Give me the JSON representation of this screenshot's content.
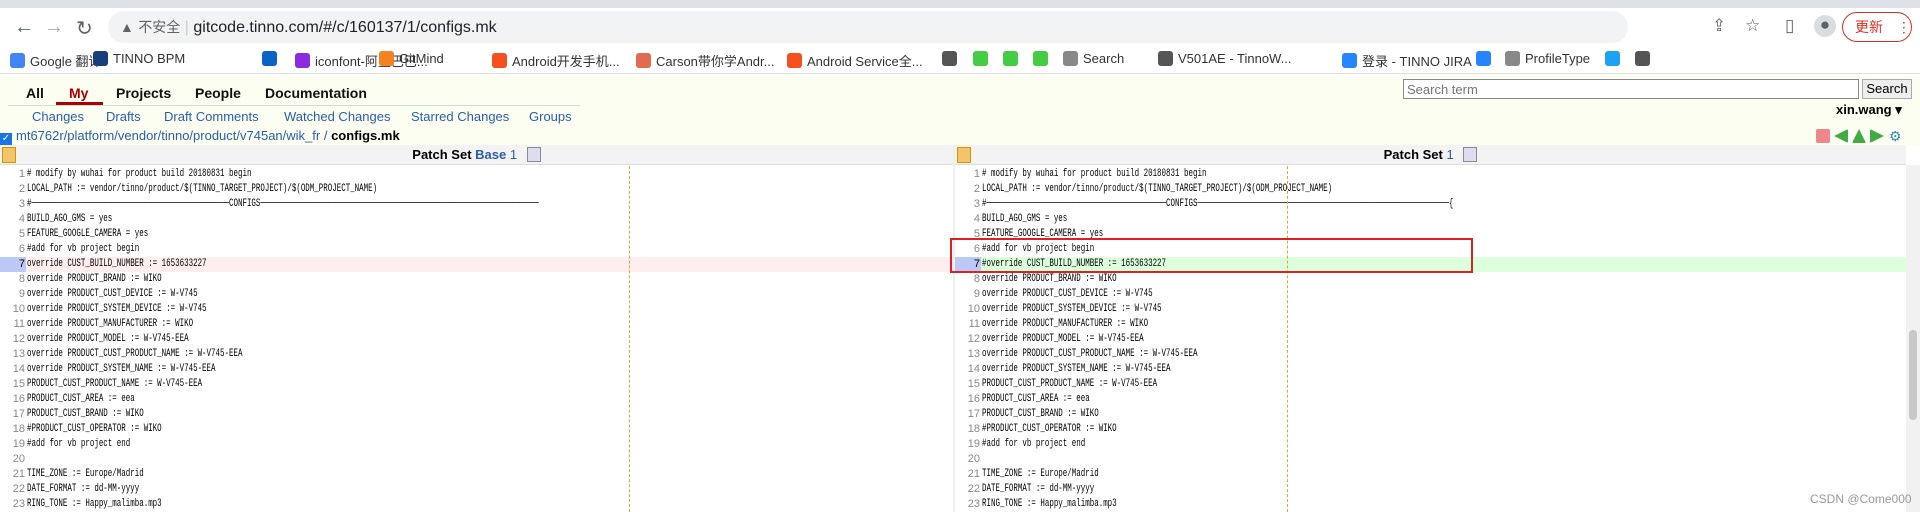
{
  "browser": {
    "security": "不安全",
    "url": "gitcode.tinno.com/#/c/160137/1/configs.mk",
    "update_label": "更新"
  },
  "bookmarks": [
    {
      "label": "Google 翻译",
      "icon": "google-translate-icon",
      "color": "#4285f4"
    },
    {
      "label": "TINNO BPM",
      "icon": "tn-icon",
      "color": "#1a3d7c"
    },
    {
      "label": "",
      "icon": "outlook-icon",
      "color": "#0a64c8"
    },
    {
      "label": "iconfont-阿里巴巴...",
      "icon": "iconfont-icon",
      "color": "#8a2be2"
    },
    {
      "label": "GitMind",
      "icon": "gitmind-icon",
      "color": "#f58220"
    },
    {
      "label": "Android开发手机...",
      "icon": "csdn-icon",
      "color": "#f4511e"
    },
    {
      "label": "Carson带你学Andr...",
      "icon": "jianshu-icon",
      "color": "#e06b50"
    },
    {
      "label": "Android Service全...",
      "icon": "csdn-icon",
      "color": "#f4511e"
    },
    {
      "label": "",
      "icon": "globe-icon",
      "color": "#555"
    },
    {
      "label": "",
      "icon": "app-icon",
      "color": "#4c4"
    },
    {
      "label": "",
      "icon": "app-icon",
      "color": "#4c4"
    },
    {
      "label": "",
      "icon": "app-icon",
      "color": "#4c4"
    },
    {
      "label": "Search",
      "icon": "braces-icon",
      "color": "#888"
    },
    {
      "label": "V501AE - TinnoW...",
      "icon": "globe-icon",
      "color": "#555"
    },
    {
      "label": "登录 - TINNO JIRA",
      "icon": "jira-icon",
      "color": "#2684ff"
    },
    {
      "label": "",
      "icon": "confluence-icon",
      "color": "#2684ff"
    },
    {
      "label": "ProfileType",
      "icon": "braces-icon",
      "color": "#888"
    },
    {
      "label": "",
      "icon": "twitter-icon",
      "color": "#1da1f2"
    },
    {
      "label": "",
      "icon": "globe-icon",
      "color": "#555"
    }
  ],
  "menu": [
    "All",
    "My",
    "Projects",
    "People",
    "Documentation"
  ],
  "submenu": [
    "Changes",
    "Drafts",
    "Draft Comments",
    "Watched Changes",
    "Starred Changes",
    "Groups"
  ],
  "search": {
    "placeholder": "Search term",
    "button": "Search"
  },
  "user": "xin.wang ▾",
  "breadcrumb": {
    "path": "mt6762r/platform/vendor/tinno/product/v745an/wik_fr",
    "sep": " / ",
    "file": "configs.mk"
  },
  "left": {
    "label": "Patch Set",
    "ps1": "Base",
    "ps2": "1"
  },
  "right": {
    "label": "Patch Set",
    "ps1": "1"
  },
  "left_lines": [
    "# modify by wuhai for product build 20180831 begin",
    "LOCAL_PATH := vendor/tinno/product/$(TINNO_TARGET_PROJECT)/$(ODM_PROJECT_NAME)",
    "#────────────────────────────────────────────CONFIGS──────────────────────────────────────────────────────────────",
    "BUILD_AGO_GMS = yes",
    "FEATURE_GOOGLE_CAMERA = yes",
    "#add for vb project begin",
    "override CUST_BUILD_NUMBER := 1653633227",
    "override PRODUCT_BRAND := WIKO",
    "override PRODUCT_CUST_DEVICE := W-V745",
    "override PRODUCT_SYSTEM_DEVICE := W-V745",
    "override PRODUCT_MANUFACTURER := WIKO",
    "override PRODUCT_MODEL := W-V745-EEA",
    "override PRODUCT_CUST_PRODUCT_NAME := W-V745-EEA",
    "override PRODUCT_SYSTEM_NAME := W-V745-EEA",
    "PRODUCT_CUST_PRODUCT_NAME := W-V745-EEA",
    "PRODUCT_CUST_AREA := eea",
    "PRODUCT_CUST_BRAND := WIKO",
    "#PRODUCT_CUST_OPERATOR := WIKO",
    "#add for vb project end",
    "",
    "TIME_ZONE := Europe/Madrid",
    "DATE_FORMAT := dd-MM-yyyy",
    "RING_TONE := Happy_malimba.mp3"
  ],
  "right_lines": [
    "# modify by wuhai for product build 20180831 begin",
    "LOCAL_PATH := vendor/tinno/product/$(TINNO_TARGET_PROJECT)/$(ODM_PROJECT_NAME)",
    "#────────────────────────────────────────CONFIGS────────────────────────────────────────────────────────{",
    "BUILD_AGO_GMS = yes",
    "FEATURE_GOOGLE_CAMERA = yes",
    "#add for vb project begin",
    "#override CUST_BUILD_NUMBER := 1653633227",
    "override PRODUCT_BRAND := WIKO",
    "override PRODUCT_CUST_DEVICE := W-V745",
    "override PRODUCT_SYSTEM_DEVICE := W-V745",
    "override PRODUCT_MANUFACTURER := WIKO",
    "override PRODUCT_MODEL := W-V745-EEA",
    "override PRODUCT_CUST_PRODUCT_NAME := W-V745-EEA",
    "override PRODUCT_SYSTEM_NAME := W-V745-EEA",
    "PRODUCT_CUST_PRODUCT_NAME := W-V745-EEA",
    "PRODUCT_CUST_AREA := eea",
    "PRODUCT_CUST_BRAND := WIKO",
    "#PRODUCT_CUST_OPERATOR := WIKO",
    "#add for vb project end",
    "",
    "TIME_ZONE := Europe/Madrid",
    "DATE_FORMAT := dd-MM-yyyy",
    "RING_TONE := Happy_malimba.mp3"
  ],
  "changed_line": 7,
  "colors": {
    "deleted": "#ffeeee",
    "added": "#dcffdc",
    "highlight_box": "#e02020"
  },
  "watermark": "CSDN @Come000"
}
